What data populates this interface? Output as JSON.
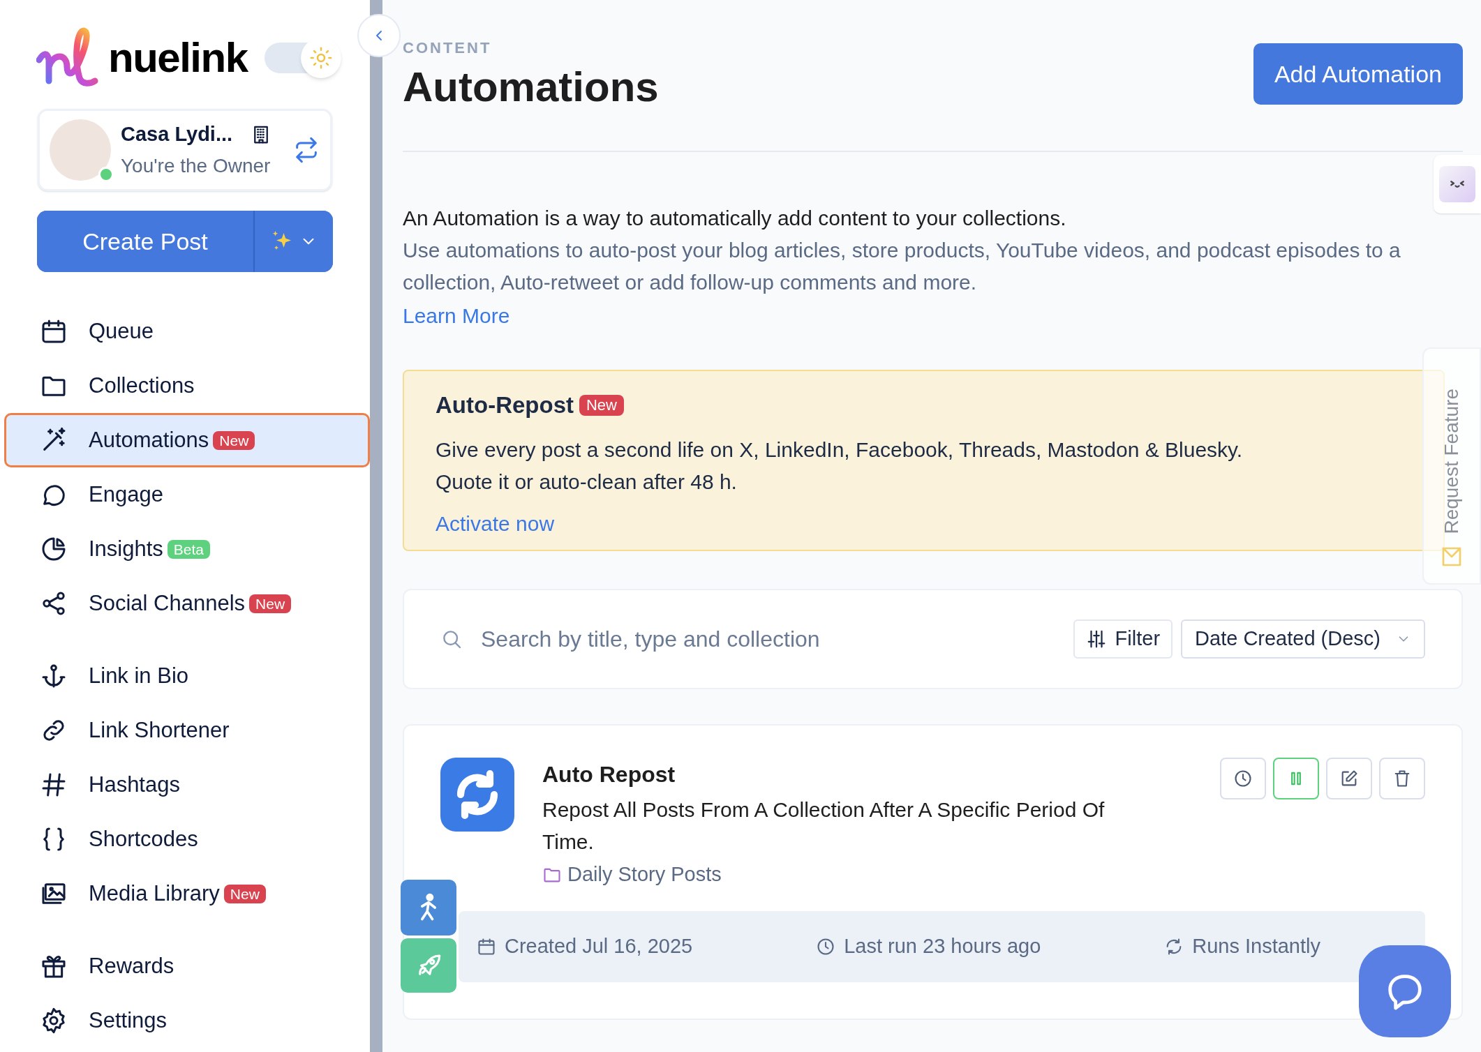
{
  "brand": {
    "name": "nuelink"
  },
  "theme_toggle": {
    "dark": false
  },
  "workspace": {
    "name": "Casa Lydi...",
    "role": "You're the Owner",
    "online": true
  },
  "create_post": {
    "label": "Create Post"
  },
  "nav_sections": [
    [
      {
        "kind": "calendar",
        "label": "Queue",
        "selected": false
      },
      {
        "kind": "folder",
        "label": "Collections",
        "selected": false
      },
      {
        "kind": "wand",
        "label": "Automations",
        "selected": true,
        "badge": {
          "text": "New",
          "color": "#d9434f"
        }
      },
      {
        "kind": "chat",
        "label": "Engage",
        "selected": false
      },
      {
        "kind": "pie",
        "label": "Insights",
        "selected": false,
        "badge": {
          "text": "Beta",
          "color": "#5ed17f"
        }
      },
      {
        "kind": "share",
        "label": "Social Channels",
        "selected": false,
        "badge": {
          "text": "New",
          "color": "#d9434f"
        }
      }
    ],
    [
      {
        "kind": "anchor",
        "label": "Link in Bio",
        "selected": false
      },
      {
        "kind": "link",
        "label": "Link Shortener",
        "selected": false
      },
      {
        "kind": "hash",
        "label": "Hashtags",
        "selected": false
      },
      {
        "kind": "braces",
        "label": "Shortcodes",
        "selected": false
      },
      {
        "kind": "images",
        "label": "Media Library",
        "selected": false,
        "badge": {
          "text": "New",
          "color": "#d9434f"
        }
      }
    ],
    [
      {
        "kind": "gift",
        "label": "Rewards",
        "selected": false
      },
      {
        "kind": "gear",
        "label": "Settings",
        "selected": false
      }
    ]
  ],
  "header": {
    "section": "CONTENT",
    "title": "Automations",
    "button": "Add Automation"
  },
  "intro": {
    "lead": "An Automation is a way to automatically add content to your collections.",
    "detail": "Use automations to auto-post your blog articles, store products, YouTube videos, and podcast episodes to a collection, Auto-retweet or add follow-up comments and more.",
    "link": "Learn More"
  },
  "promo": {
    "title": "Auto-Repost",
    "badge": "New",
    "lines": [
      "Give every post a second life on X, LinkedIn, Facebook, Threads, Mastodon & Bluesky.",
      "Quote it or auto-clean after 48 h."
    ],
    "link": "Activate now"
  },
  "toolbar": {
    "placeholder": "Search by title, type and collection",
    "filter": "Filter",
    "sort": "Date Created (Desc)"
  },
  "automations": [
    {
      "title": "Auto Repost",
      "description": "Repost All Posts From A Collection After A Specific Period Of Time.",
      "collection": "Daily Story Posts",
      "created": "Created Jul 16, 2025",
      "last_run": "Last run 23 hours ago",
      "schedule": "Runs Instantly"
    }
  ],
  "request_feature": "Request Feature"
}
